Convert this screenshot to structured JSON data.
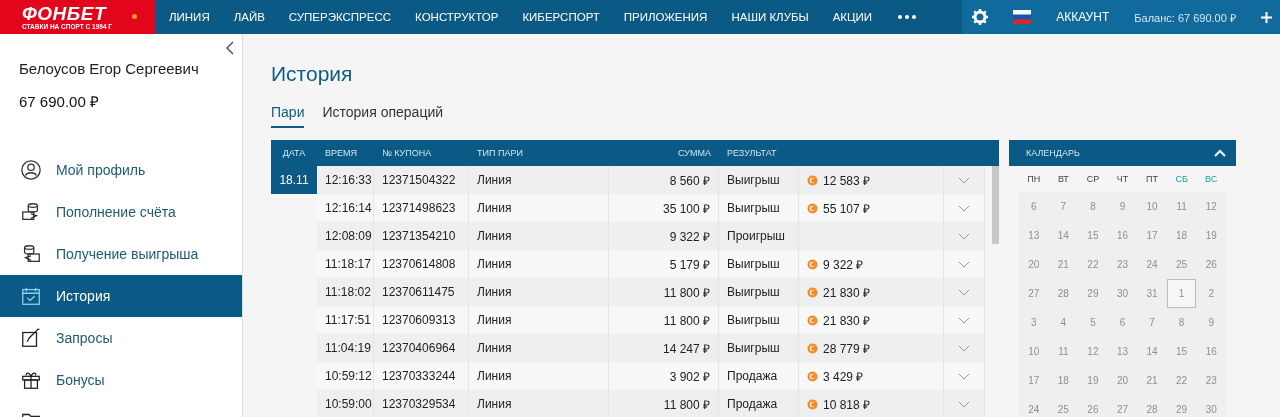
{
  "header": {
    "logo": "ФОНБЕТ",
    "tagline": "СТАВКИ НА СПОРТ С 1994 Г",
    "nav": [
      {
        "label": "ЛИНИЯ"
      },
      {
        "label": "ЛАЙВ"
      },
      {
        "label": "СУПЕРЭКСПРЕСС"
      },
      {
        "label": "КОНСТРУКТОР"
      },
      {
        "label": "КИБЕРСПОРТ"
      },
      {
        "label": "ПРИЛОЖЕНИЯ"
      },
      {
        "label": "НАШИ КЛУБЫ"
      },
      {
        "label": "АКЦИИ"
      }
    ],
    "account": "АККАУНТ",
    "balance": "Баланс: 67 690.00 ₽"
  },
  "sidebar": {
    "user": "Белоусов Егор Сергеевич",
    "balance": "67 690.00 ₽",
    "items": [
      {
        "kind": "profile",
        "label": "Мой профиль",
        "selected": false
      },
      {
        "kind": "deposit",
        "label": "Пополнение счёта",
        "selected": false
      },
      {
        "kind": "withdraw",
        "label": "Получение выигрыша",
        "selected": false
      },
      {
        "kind": "history",
        "label": "История",
        "selected": true
      },
      {
        "kind": "requests",
        "label": "Запросы",
        "selected": false
      },
      {
        "kind": "bonus",
        "label": "Бонусы",
        "selected": false
      },
      {
        "kind": "folder",
        "selected": false
      }
    ]
  },
  "title": "История",
  "tabs": [
    {
      "label": "Пари",
      "selected": true
    },
    {
      "label": "История операций",
      "selected": false
    }
  ],
  "table": {
    "columns": [
      "ДАТА",
      "ВРЕМЯ",
      "№ КУПОНА",
      "ТИП ПАРИ",
      "СУММА",
      "РЕЗУЛЬТАТ"
    ],
    "rows": [
      {
        "date": "18.11",
        "time": "12:16:33",
        "coupon": "12371504322",
        "type": "Линия",
        "sum": "8 560 ₽",
        "result": "Выигрыш",
        "payout": "12 583 ₽"
      },
      {
        "time": "12:16:14",
        "coupon": "12371498623",
        "type": "Линия",
        "sum": "35 100 ₽",
        "result": "Выигрыш",
        "payout": "55 107 ₽"
      },
      {
        "time": "12:08:09",
        "coupon": "12371354210",
        "type": "Линия",
        "sum": "9 322 ₽",
        "result": "Проигрыш"
      },
      {
        "time": "11:18:17",
        "coupon": "12370614808",
        "type": "Линия",
        "sum": "5 179 ₽",
        "result": "Выигрыш",
        "payout": "9 322 ₽"
      },
      {
        "time": "11:18:02",
        "coupon": "12370611475",
        "type": "Линия",
        "sum": "11 800 ₽",
        "result": "Выигрыш",
        "payout": "21 830 ₽"
      },
      {
        "time": "11:17:51",
        "coupon": "12370609313",
        "type": "Линия",
        "sum": "11 800 ₽",
        "result": "Выигрыш",
        "payout": "21 830 ₽"
      },
      {
        "time": "11:04:19",
        "coupon": "12370406964",
        "type": "Линия",
        "sum": "14 247 ₽",
        "result": "Выигрыш",
        "payout": "28 779 ₽"
      },
      {
        "time": "10:59:12",
        "coupon": "12370333244",
        "type": "Линия",
        "sum": "3 902 ₽",
        "result": "Продажа",
        "payout": "3 429 ₽"
      },
      {
        "time": "10:59:00",
        "coupon": "12370329534",
        "type": "Линия",
        "sum": "11 800 ₽",
        "result": "Продажа",
        "payout": "10 818 ₽"
      }
    ]
  },
  "calendar": {
    "title": "КАЛЕНДАРЬ",
    "expanded": true,
    "weekdays": [
      {
        "label": "ПН",
        "weekend": false
      },
      {
        "label": "ВТ",
        "weekend": false
      },
      {
        "label": "СР",
        "weekend": false
      },
      {
        "label": "ЧТ",
        "weekend": false
      },
      {
        "label": "ПТ",
        "weekend": false
      },
      {
        "label": "СБ",
        "weekend": true
      },
      {
        "label": "ВС",
        "weekend": true
      }
    ],
    "weeks": [
      [
        {
          "day": "6",
          "selected": false
        },
        {
          "day": "7",
          "selected": false
        },
        {
          "day": "8",
          "selected": false
        },
        {
          "day": "9",
          "selected": false
        },
        {
          "day": "10",
          "selected": false
        },
        {
          "day": "11",
          "selected": false
        },
        {
          "day": "12",
          "selected": false
        }
      ],
      [
        {
          "day": "13",
          "selected": false
        },
        {
          "day": "14",
          "selected": false
        },
        {
          "day": "15",
          "selected": false
        },
        {
          "day": "16",
          "selected": false
        },
        {
          "day": "17",
          "selected": false
        },
        {
          "day": "18",
          "selected": false
        },
        {
          "day": "19",
          "selected": false
        }
      ],
      [
        {
          "day": "20",
          "selected": false
        },
        {
          "day": "21",
          "selected": false
        },
        {
          "day": "22",
          "selected": false
        },
        {
          "day": "23",
          "selected": false
        },
        {
          "day": "24",
          "selected": false
        },
        {
          "day": "25",
          "selected": false
        },
        {
          "day": "26",
          "selected": false
        }
      ],
      [
        {
          "day": "27",
          "selected": false
        },
        {
          "day": "28",
          "selected": false
        },
        {
          "day": "29",
          "selected": false
        },
        {
          "day": "30",
          "selected": false
        },
        {
          "day": "31",
          "selected": false
        },
        {
          "day": "1",
          "selected": true
        },
        {
          "day": "2",
          "selected": false
        }
      ],
      [
        {
          "day": "3",
          "selected": false
        },
        {
          "day": "4",
          "selected": false
        },
        {
          "day": "5",
          "selected": false
        },
        {
          "day": "6",
          "selected": false
        },
        {
          "day": "7",
          "selected": false
        },
        {
          "day": "8",
          "selected": false
        },
        {
          "day": "9",
          "selected": false
        }
      ],
      [
        {
          "day": "10",
          "selected": false
        },
        {
          "day": "11",
          "selected": false
        },
        {
          "day": "12",
          "selected": false
        },
        {
          "day": "13",
          "selected": false
        },
        {
          "day": "14",
          "selected": false
        },
        {
          "day": "15",
          "selected": false
        },
        {
          "day": "16",
          "selected": false
        }
      ],
      [
        {
          "day": "17",
          "selected": false
        },
        {
          "day": "18",
          "selected": false
        },
        {
          "day": "19",
          "selected": false
        },
        {
          "day": "20",
          "selected": false
        },
        {
          "day": "21",
          "selected": false
        },
        {
          "day": "22",
          "selected": false
        },
        {
          "day": "23",
          "selected": false
        }
      ],
      [
        {
          "day": "24",
          "selected": false
        },
        {
          "day": "25",
          "selected": false
        },
        {
          "day": "26",
          "selected": false
        },
        {
          "day": "27",
          "selected": false
        },
        {
          "day": "28",
          "selected": false
        },
        {
          "day": "29",
          "selected": false
        },
        {
          "day": "30",
          "selected": false
        }
      ]
    ]
  }
}
